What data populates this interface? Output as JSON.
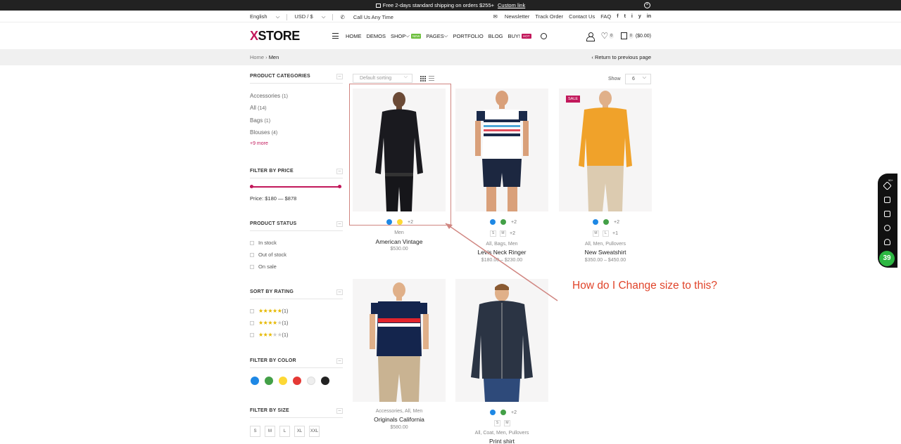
{
  "topbar": {
    "text": "Free 2-days standard shipping on orders $255+",
    "link": "Custom link"
  },
  "utilbar": {
    "language": "English",
    "currency": "USD / $",
    "phone": "Call Us Any Time",
    "newsletter": "Newsletter",
    "track": "Track Order",
    "contact": "Contact Us",
    "faq": "FAQ",
    "social": [
      "f",
      "t",
      "i",
      "y",
      "in"
    ]
  },
  "header": {
    "logo_x": "X",
    "logo_rest": "STORE",
    "nav": {
      "home": "HOME",
      "demos": "DEMOS",
      "shop": "SHOP",
      "shop_badge": "NEW",
      "pages": "PAGES",
      "portfolio": "PORTFOLIO",
      "blog": "BLOG",
      "buy": "BUY!",
      "buy_badge": "HOT"
    },
    "wishlist_count": "0",
    "cart_count": "0",
    "cart_total": "($0.00)"
  },
  "breadcrumb": {
    "home": "Home",
    "current": "Men",
    "return": "Return to previous page"
  },
  "sidebar": {
    "categories_title": "PRODUCT CATEGORIES",
    "categories": [
      {
        "label": "Accessories",
        "count": "(1)"
      },
      {
        "label": "All",
        "count": "(14)"
      },
      {
        "label": "Bags",
        "count": "(1)"
      },
      {
        "label": "Blouses",
        "count": "(4)"
      }
    ],
    "more": "+9 more",
    "price_title": "FILTER BY PRICE",
    "price_text": "Price: $180 — $878",
    "status_title": "PRODUCT STATUS",
    "status": [
      "In stock",
      "Out of stock",
      "On sale"
    ],
    "rating_title": "SORT BY RATING",
    "ratings": [
      {
        "on": "★★★★★",
        "off": "",
        "count": "(1)"
      },
      {
        "on": "★★★★",
        "off": "★",
        "count": "(1)"
      },
      {
        "on": "★★★",
        "off": "★★",
        "count": "(1)"
      }
    ],
    "color_title": "FILTER BY COLOR",
    "colors": [
      "#1e88e5",
      "#43a047",
      "#fdd835",
      "#e53935",
      "#eeeeee",
      "#222222"
    ],
    "size_title": "FILTER BY SIZE",
    "sizes": [
      "S",
      "M",
      "L",
      "XL",
      "XXL"
    ]
  },
  "toolbar": {
    "sort": "Default sorting",
    "show_label": "Show",
    "show_value": "6"
  },
  "products": [
    {
      "cat": "Men",
      "name": "American Vintage",
      "price": "$530.00",
      "colors": [
        "#1e88e5",
        "#fdd835"
      ],
      "colors_more": "+2"
    },
    {
      "cat": "All, Bags, Men",
      "name": "Levis Neck Ringer",
      "price": "$180.00 – $230.00",
      "colors": [
        "#1e88e5",
        "#43a047"
      ],
      "colors_more": "+2",
      "sizes": [
        "S",
        "M"
      ],
      "sizes_more": "+2"
    },
    {
      "cat": "All, Men, Pullovers",
      "name": "New Sweatshirt",
      "price": "$350.00 – $450.00",
      "badge": "SALE",
      "colors": [
        "#1e88e5",
        "#43a047"
      ],
      "colors_more": "+2",
      "sizes": [
        "M",
        "L"
      ],
      "sizes_more": "+1"
    },
    {
      "cat": "Accessories, All, Men",
      "name": "Originals California",
      "price": "$580.00"
    },
    {
      "cat": "All, Coat, Men, Pullovers",
      "name": "Print shirt",
      "colors": [
        "#1e88e5",
        "#43a047"
      ],
      "colors_more": "+2",
      "sizes": [
        "S",
        "M"
      ]
    }
  ],
  "annotation": {
    "text": "How do I Change size to this?",
    "color": "#e0442a"
  },
  "floatbar": {
    "tag": "90+",
    "badge": "39"
  }
}
